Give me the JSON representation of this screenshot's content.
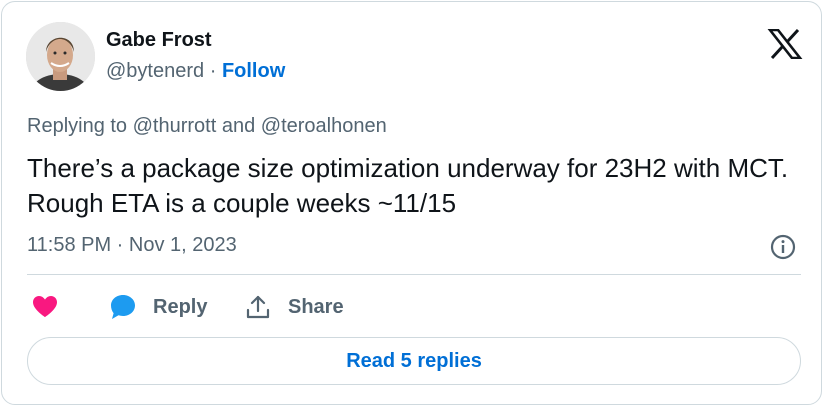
{
  "author": {
    "name": "Gabe Frost",
    "handle": "@bytenerd",
    "separator": "·",
    "follow_label": "Follow",
    "avatar_icon": "person-avatar"
  },
  "brand": {
    "logo_icon": "x-logo-icon"
  },
  "tweet": {
    "reply_context": "Replying to @thurrott and @teroalhonen",
    "text": "There’s a package size optimization underway for 23H2 with MCT. Rough ETA is a couple weeks ~11/15",
    "timestamp": "11:58 PM · Nov 1, 2023"
  },
  "actions": {
    "like_icon": "heart-icon",
    "reply_label": "Reply",
    "share_label": "Share",
    "read_replies_label": "Read 5 replies"
  },
  "colors": {
    "accent": "#006fd6",
    "like": "#f91880",
    "reply_bubble": "#1d9bf0",
    "secondary_text": "#536471",
    "border": "#cfd9de"
  }
}
